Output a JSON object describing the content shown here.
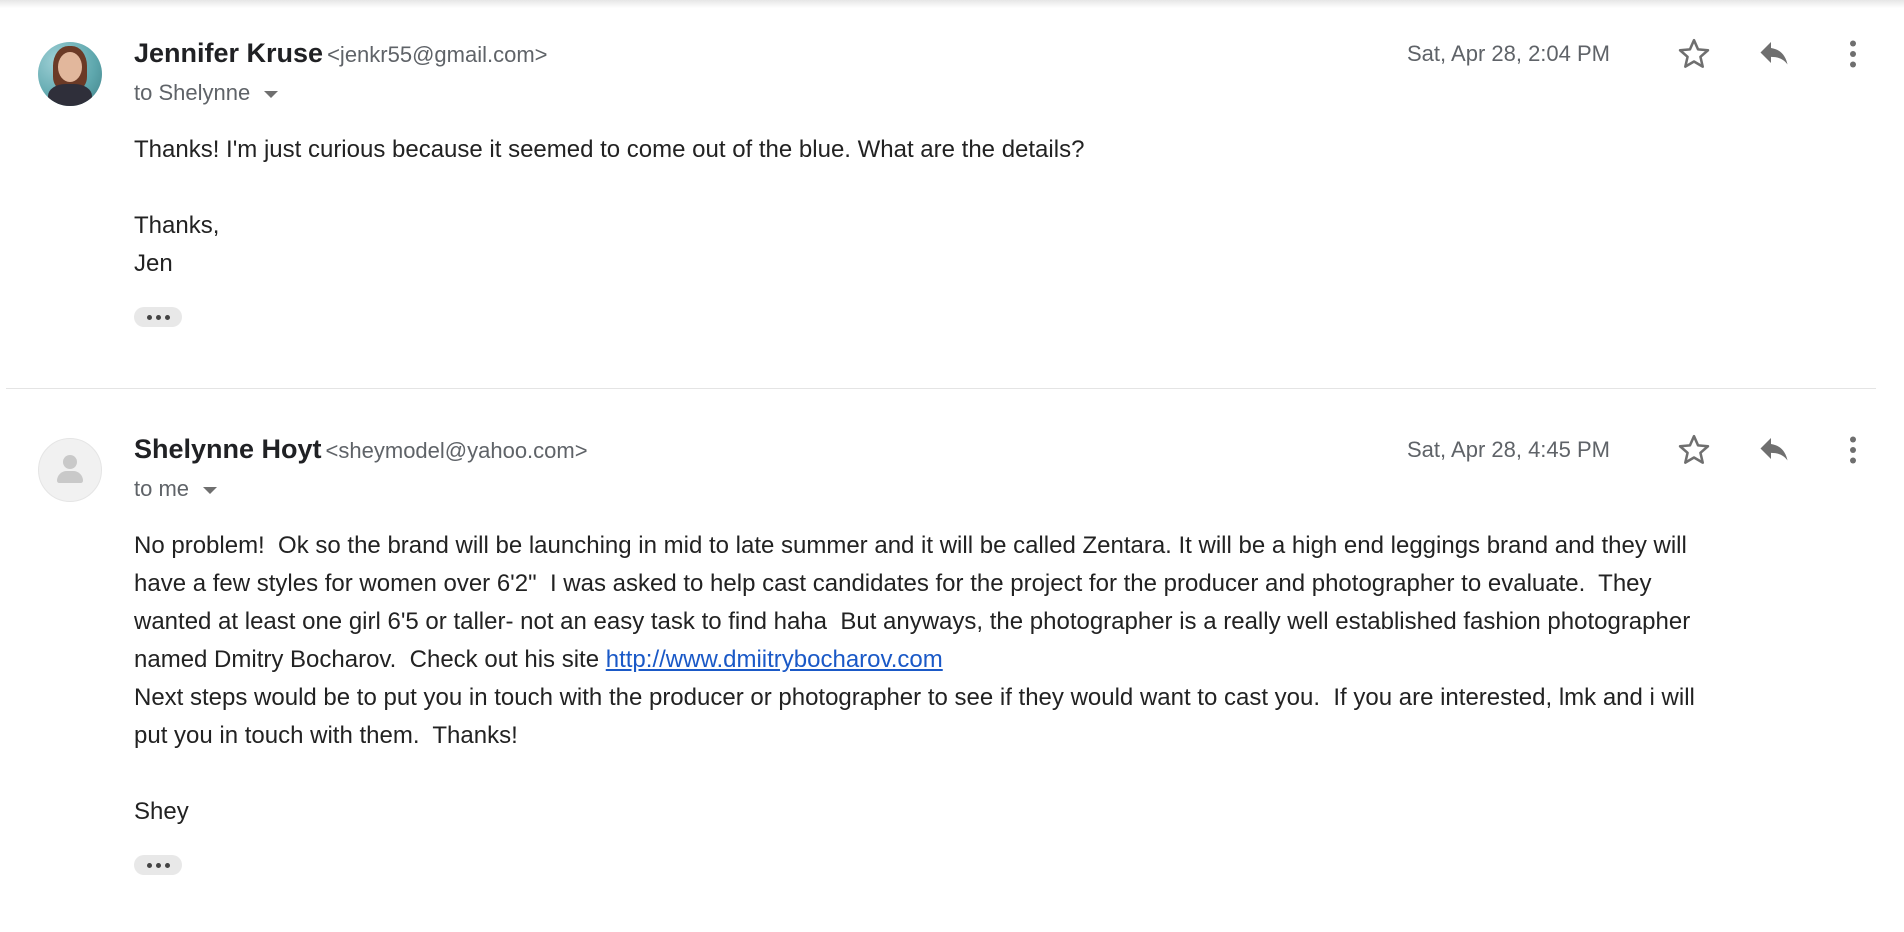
{
  "messages": [
    {
      "sender_name": "Jennifer Kruse",
      "sender_email": "<jenkr55@gmail.com>",
      "recipient": "to Shelynne",
      "date": "Sat, Apr 28, 2:04 PM",
      "avatar": "person-photo",
      "body": [
        "Thanks! I'm just curious because it seemed to come out of the blue. What are the details?",
        "",
        "Thanks,",
        "Jen"
      ]
    },
    {
      "sender_name": "Shelynne Hoyt",
      "sender_email": "<sheymodel@yahoo.com>",
      "recipient": "to me",
      "date": "Sat, Apr 28, 4:45 PM",
      "avatar": "default-person-placeholder",
      "body_line1": "No problem!  Ok so the brand will be launching in mid to late summer and it will be called Zentara. It will be a high end leggings brand and they will",
      "body_line2": "have a few styles for women over 6'2\"  I was asked to help cast candidates for the project for the producer and photographer to evaluate.  They",
      "body_line3": "wanted at least one girl 6'5 or taller- not an easy task to find haha  But anyways, the photographer is a really well established fashion photographer",
      "body_line4_prefix": "named Dmitry Bocharov.  Check out his site ",
      "link": "http://www.dmiitrybocharov.com",
      "body_line5": "Next steps would be to put you in touch with the producer or photographer to see if they would want to cast you.  If you are interested, lmk and i will",
      "body_line6": "put you in touch with them.  Thanks!",
      "signature": "Shey"
    }
  ],
  "icons": {
    "star": "star-outline-icon",
    "reply": "reply-arrow-icon",
    "more": "more-vertical-icon",
    "trimmed": "show-trimmed-content-icon"
  },
  "colors": {
    "link": "#1a59c7",
    "secondary_text": "#5f6368",
    "icon": "#6f6f6f"
  }
}
